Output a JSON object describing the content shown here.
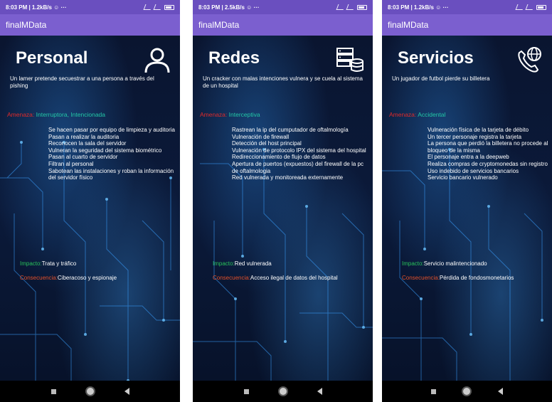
{
  "status_bars": [
    {
      "left": "8:03 PM | 1.2kB/s ☺ ···"
    },
    {
      "left": "8:03 PM | 2.5kB/s ☺ ···"
    },
    {
      "left": "8:03 PM | 1.2kB/s ☺ ···"
    }
  ],
  "app_title": "finalMData",
  "screens": [
    {
      "title": "Personal",
      "icon": "person-icon",
      "description": "Un lamer pretende secuestrar a una persona a través del pishing",
      "threat_label": "Amenaza:",
      "threat_value": "Interruptora, Intencionada",
      "vulnerabilities": [
        "Se hacen pasar por equipo de limpieza y auditoria",
        "Pasan a realizar la auditoria",
        "Reconocen la sala del servidor",
        "Vulneran la seguridad del sistema biométrico",
        "Pasan al cuarto de servidor",
        "Filtran al personal",
        "Sabotean las instalaciones y roban la información del servidor físico"
      ],
      "impact_label": "Impacto:",
      "impact_value": "Trata y tráfico",
      "consequence_label": "Consecuencia:",
      "consequence_value": "Ciberacoso y espionaje"
    },
    {
      "title": "Redes",
      "icon": "server-database-icon",
      "description": "Un cracker con malas intenciones vulnera y se cuela al sistema de un hospital",
      "threat_label": "Amenaza:",
      "threat_value": "Interceptiva",
      "vulnerabilities": [
        "Rastrean la ip del cumputador de oftalmología",
        "Vulneración de firewall",
        "Detección del host principal",
        "Vulneración de protocolo IPX del sistema del hospital",
        "Redireccionamiento de flujo de datos",
        "Apertura de puertos (expuestos) del firewall de la pc de oftalmologia",
        "Red vulnerada y monitoreada externamente"
      ],
      "impact_label": "Impacto:",
      "impact_value": "Red vulnerada",
      "consequence_label": "Consecuencia:",
      "consequence_value": "Acceso ilegal de datos del hospital"
    },
    {
      "title": "Servicios",
      "icon": "phone-globe-icon",
      "description": "Un jugador de futbol pierde su billetera",
      "threat_label": "Amenaza:",
      "threat_value": "Accidental",
      "vulnerabilities": [
        "Vulneración física de la tarjeta de débito",
        "Un tercer personaje registra la tarjeta",
        "La persona que perdió la billetera no procede al bloqueo de la misma",
        "El personaje entra a la deepweb",
        "Realiza compras de cryptomonedas sin registro",
        "Uso indebido de servicios bancarios",
        "Servicio bancario vulnerado"
      ],
      "impact_label": "Impacto:",
      "impact_value": "Servicio malintencionado",
      "consequence_label": "Consecuencia:",
      "consequence_value": "Pérdida de fondosmonetarios"
    }
  ],
  "colors": {
    "app_bar": "#7b5fcf",
    "status_bar": "#6a4fbf",
    "threat_label": "#e02a2a",
    "threat_value": "#23c8a6",
    "impact_label": "#29c15a",
    "consequence_label": "#e2502a"
  }
}
